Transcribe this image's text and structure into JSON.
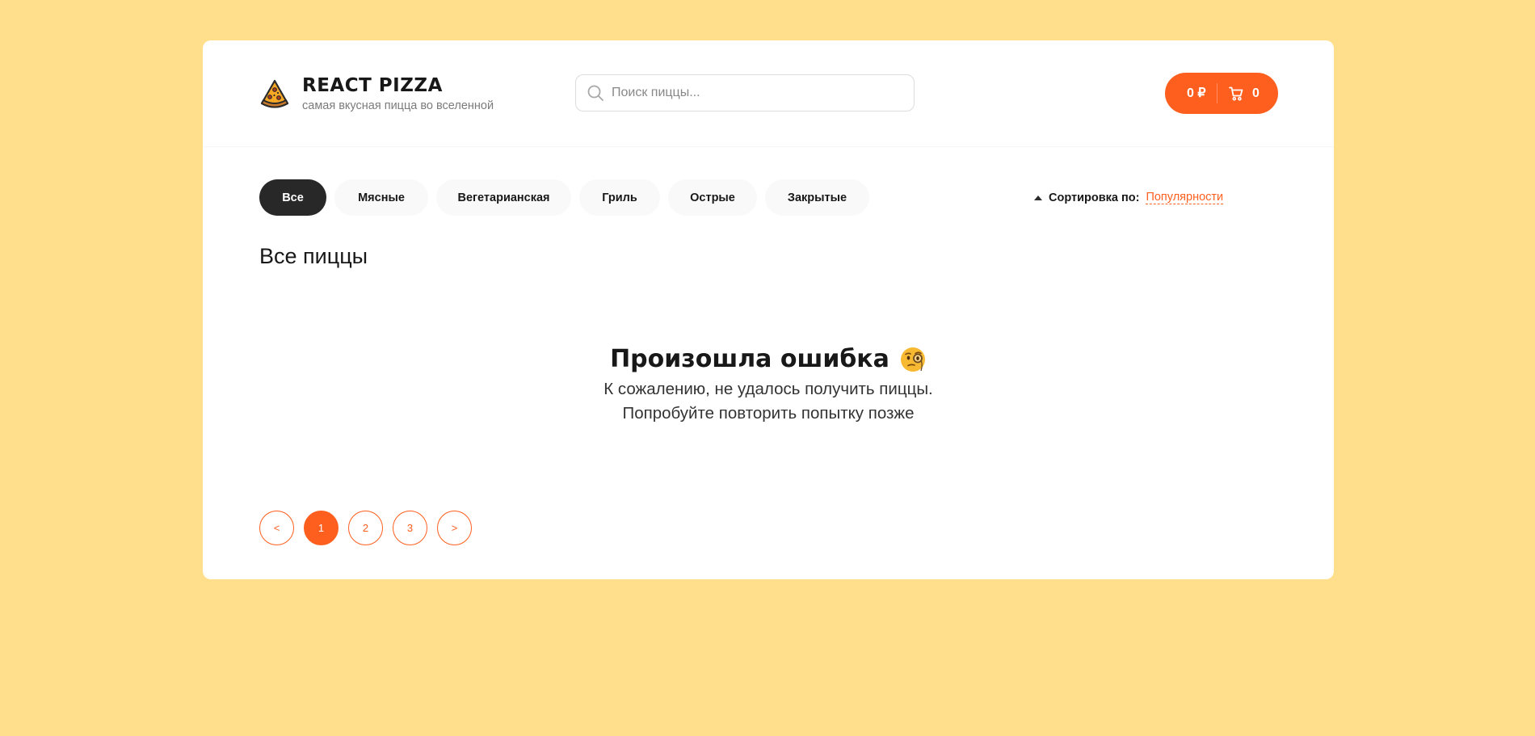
{
  "header": {
    "logo_title": "REACT PIZZA",
    "logo_subtitle": "самая вкусная пицца во вселенной",
    "search_placeholder": "Поиск пиццы...",
    "cart_price": "0 ₽",
    "cart_count": "0"
  },
  "categories": [
    {
      "label": "Все",
      "active": true
    },
    {
      "label": "Мясные",
      "active": false
    },
    {
      "label": "Вегетарианская",
      "active": false
    },
    {
      "label": "Гриль",
      "active": false
    },
    {
      "label": "Острые",
      "active": false
    },
    {
      "label": "Закрытые",
      "active": false
    }
  ],
  "sort": {
    "label": "Сортировка по:",
    "value": "Популярности"
  },
  "content": {
    "title": "Все пиццы",
    "error_title": "Произошла ошибка",
    "error_line1": "К сожалению, не удалось получить пиццы.",
    "error_line2": "Попробуйте повторить попытку позже"
  },
  "pagination": {
    "prev": "<",
    "pages": [
      "1",
      "2",
      "3"
    ],
    "active_page": "1",
    "next": ">"
  },
  "colors": {
    "background": "#ffdf8c",
    "accent": "#fe5f1e",
    "active_category": "#282828"
  }
}
